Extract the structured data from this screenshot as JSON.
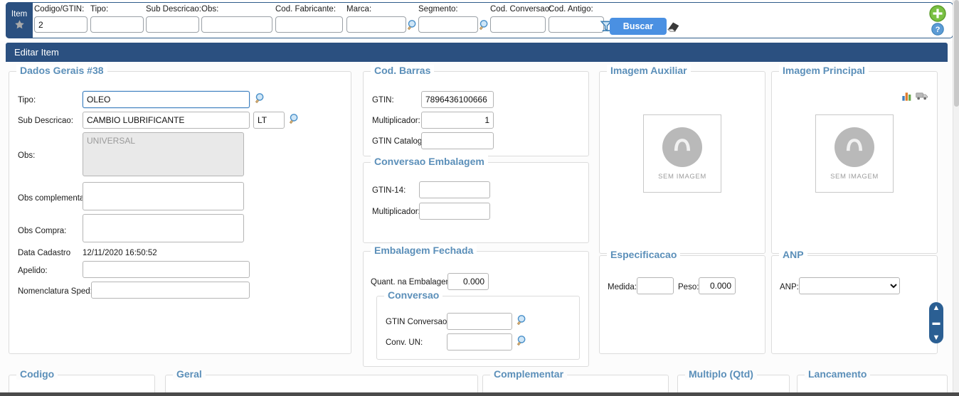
{
  "toolbar": {
    "tab_label": "Item",
    "tab_icon": "star-icon",
    "fields": [
      {
        "label": "Codigo/GTIN:",
        "value": "2"
      },
      {
        "label": "Tipo:",
        "value": ""
      },
      {
        "label": "Sub Descricao:",
        "value": ""
      },
      {
        "label": "Obs:",
        "value": ""
      },
      {
        "label": "Cod. Fabricante:",
        "value": ""
      },
      {
        "label": "Marca:",
        "value": ""
      },
      {
        "label": "Segmento:",
        "value": ""
      },
      {
        "label": "Cod. Conversao:",
        "value": ""
      },
      {
        "label": "Cod. Antigo:",
        "value": ""
      }
    ],
    "filter_icon": "filter-funnel-icon",
    "search_label": "Buscar",
    "eraser_icon": "eraser-icon",
    "add_icon": "add-plus-icon",
    "help_icon": "help-question-icon"
  },
  "header": {
    "title": "Editar Item"
  },
  "dados_gerais": {
    "legend": "Dados Gerais #38",
    "tipo_label": "Tipo:",
    "tipo_value": "OLEO",
    "sub_descricao_label": "Sub Descricao:",
    "sub_descricao_value": "CAMBIO LUBRIFICANTE",
    "unidade_value": "LT",
    "obs_label": "Obs:",
    "obs_value": "UNIVERSAL",
    "obs_complementar_label": "Obs complementar:",
    "obs_complementar_value": "",
    "obs_compra_label": "Obs Compra:",
    "obs_compra_value": "",
    "data_cadastro_label": "Data Cadastro",
    "data_cadastro_value": "12/11/2020 16:50:52",
    "apelido_label": "Apelido:",
    "apelido_value": "",
    "nomenclatura_label": "Nomenclatura Sped:",
    "nomenclatura_value": ""
  },
  "cod_barras": {
    "legend": "Cod. Barras",
    "gtin_label": "GTIN:",
    "gtin_value": "7896436100666",
    "multiplicador_label": "Multiplicador:",
    "multiplicador_value": "1",
    "gtin_catalogo_label": "GTIN Catalogo:",
    "gtin_catalogo_value": ""
  },
  "conversao_embalagem": {
    "legend": "Conversao Embalagem",
    "gtin14_label": "GTIN-14:",
    "gtin14_value": "",
    "multiplicador_label": "Multiplicador:",
    "multiplicador_value": ""
  },
  "embalagem_fechada": {
    "legend": "Embalagem Fechada",
    "quant_label": "Quant. na Embalagem:",
    "quant_value": "0.000",
    "conversao": {
      "legend": "Conversao",
      "gtin_conversao_label": "GTIN Conversao:",
      "gtin_conversao_value": "",
      "conv_un_label": "Conv. UN:",
      "conv_un_value": ""
    }
  },
  "imagem_auxiliar": {
    "legend": "Imagem Auxiliar",
    "placeholder_caption": "SEM IMAGEM"
  },
  "imagem_principal": {
    "legend": "Imagem Principal",
    "placeholder_caption": "SEM IMAGEM",
    "chart_icon": "bar-chart-icon",
    "truck_icon": "truck-icon"
  },
  "especificacao": {
    "legend": "Especificacao",
    "medida_label": "Medida:",
    "medida_value": "",
    "peso_label": "Peso:",
    "peso_value": "0.000"
  },
  "anp": {
    "legend": "ANP",
    "anp_label": "ANP:",
    "anp_value": "",
    "anp_options": [
      ""
    ]
  },
  "scroll_widget": {
    "up_icon": "chevron-up-icon",
    "collapse_icon": "minus-icon",
    "down_icon": "chevron-down-icon"
  },
  "bottom_sections": [
    {
      "legend": "Codigo"
    },
    {
      "legend": "Geral"
    },
    {
      "legend": "Complementar"
    },
    {
      "legend": "Multiplo (Qtd)"
    },
    {
      "legend": "Lancamento"
    }
  ],
  "colors": {
    "header_blue": "#2b5080",
    "legend_blue": "#5b8fb9",
    "button_blue": "#4a90e2",
    "accent_green": "#7ac143"
  }
}
